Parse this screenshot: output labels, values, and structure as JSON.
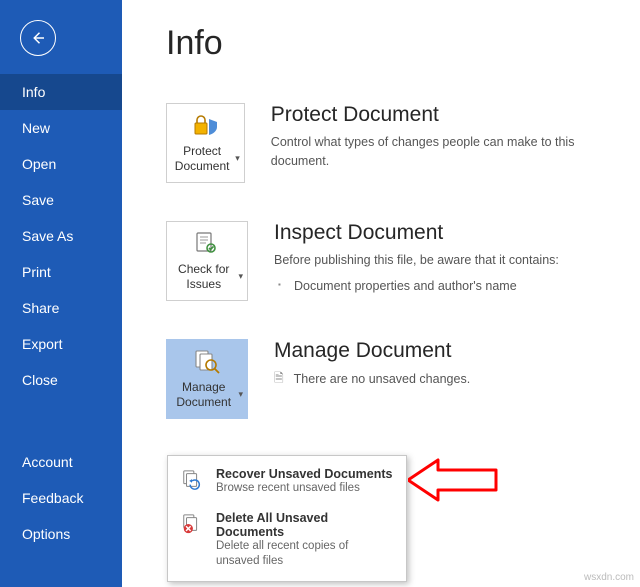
{
  "pageTitle": "Info",
  "sidebar": {
    "items": {
      "info": "Info",
      "new": "New",
      "open": "Open",
      "save": "Save",
      "saveAs": "Save As",
      "print": "Print",
      "share": "Share",
      "export": "Export",
      "close": "Close",
      "account": "Account",
      "feedback": "Feedback",
      "options": "Options"
    }
  },
  "tiles": {
    "protect": "Protect Document",
    "check": "Check for Issues",
    "manage": "Manage Document"
  },
  "sections": {
    "protect": {
      "title": "Protect Document",
      "desc": "Control what types of changes people can make to this document."
    },
    "inspect": {
      "title": "Inspect Document",
      "desc": "Before publishing this file, be aware that it contains:",
      "bullet1": "Document properties and author's name"
    },
    "manage": {
      "title": "Manage Document",
      "unsaved": "There are no unsaved changes."
    }
  },
  "menu": {
    "recover": {
      "title": "Recover Unsaved Documents",
      "sub": "Browse recent unsaved files"
    },
    "delete": {
      "title": "Delete All Unsaved Documents",
      "sub": "Delete all recent copies of unsaved files"
    }
  },
  "watermark": "wsxdn.com"
}
